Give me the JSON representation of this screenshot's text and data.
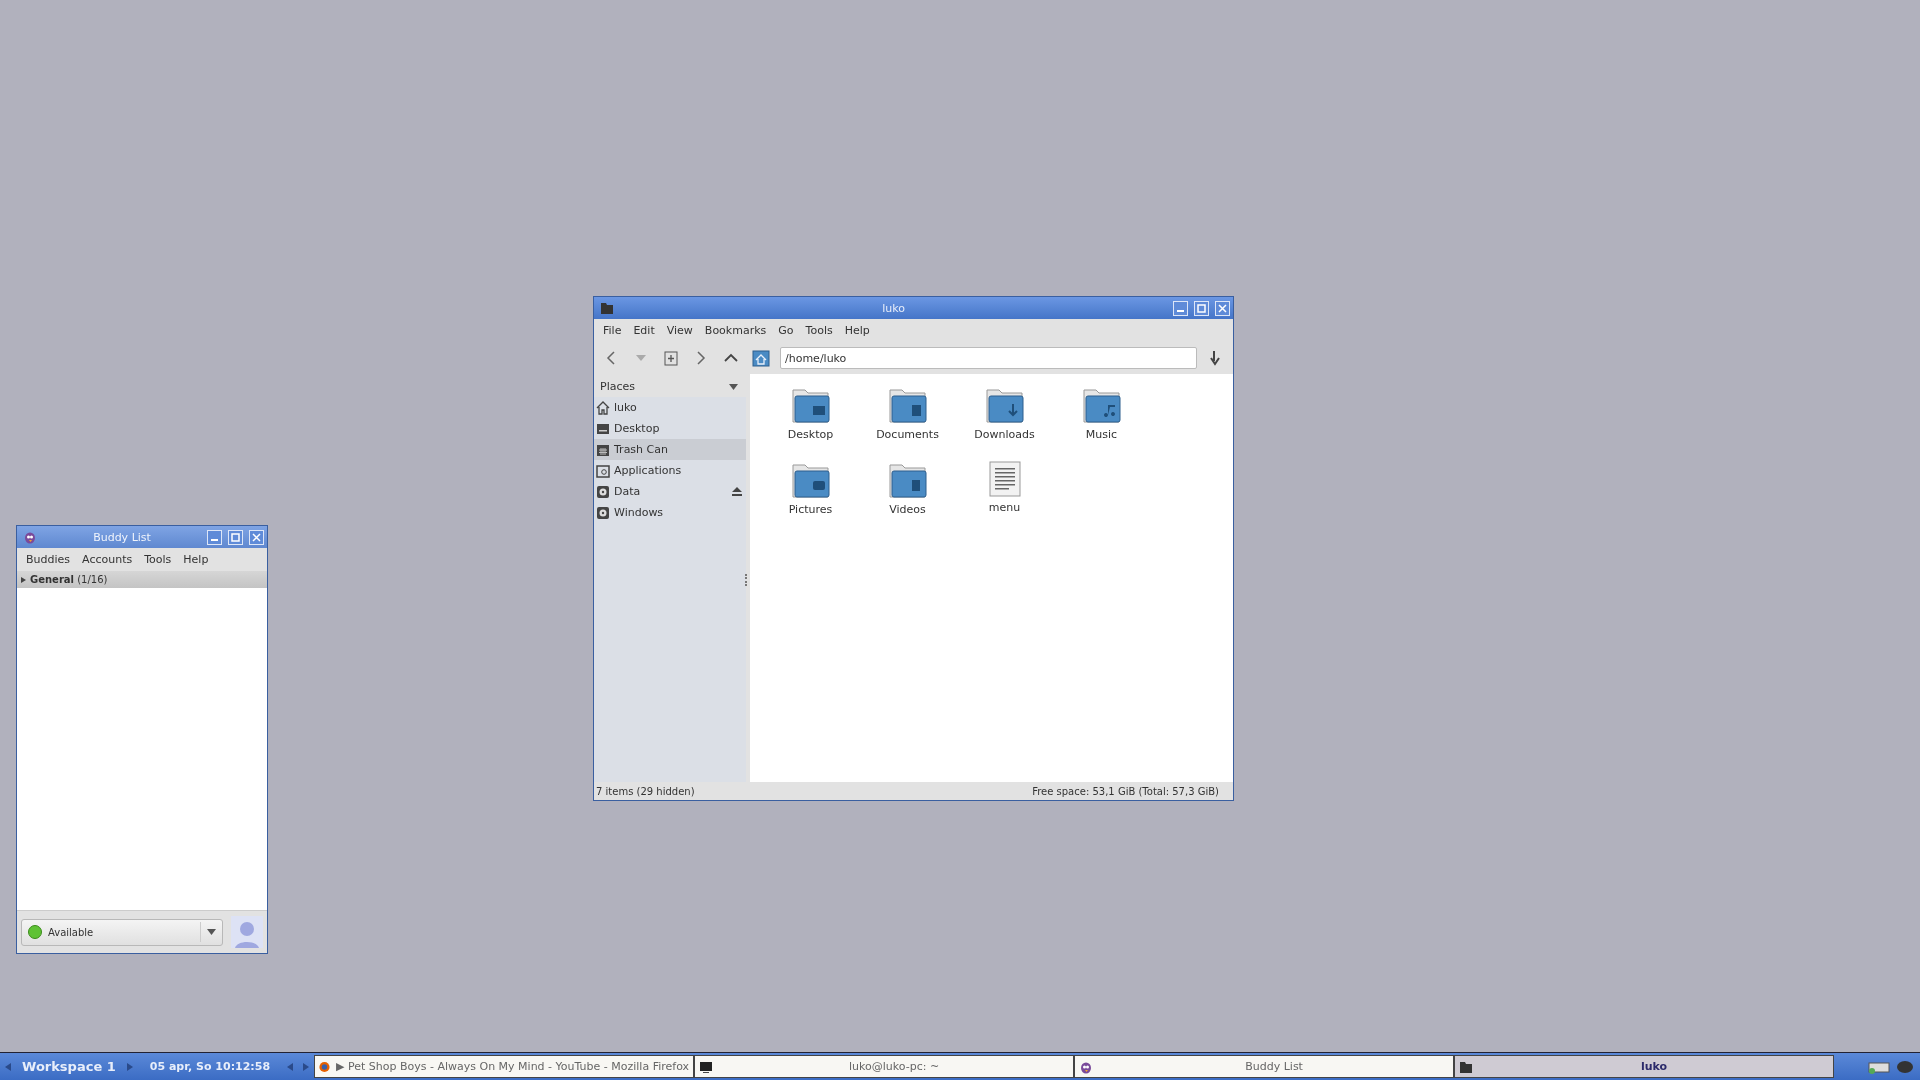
{
  "file_manager": {
    "title": "luko",
    "menu": [
      "File",
      "Edit",
      "View",
      "Bookmarks",
      "Go",
      "Tools",
      "Help"
    ],
    "location": "/home/luko",
    "places_header": "Places",
    "places": [
      {
        "label": "luko",
        "kind": "home",
        "selected": false,
        "eject": false
      },
      {
        "label": "Desktop",
        "kind": "desktop",
        "selected": false,
        "eject": false
      },
      {
        "label": "Trash Can",
        "kind": "trash",
        "selected": true,
        "eject": false
      },
      {
        "label": "Applications",
        "kind": "apps",
        "selected": false,
        "eject": false
      },
      {
        "label": "Data",
        "kind": "drive",
        "selected": false,
        "eject": true
      },
      {
        "label": "Windows",
        "kind": "drive",
        "selected": false,
        "eject": false
      }
    ],
    "files": [
      {
        "name": "Desktop",
        "kind": "desktop"
      },
      {
        "name": "Documents",
        "kind": "documents"
      },
      {
        "name": "Downloads",
        "kind": "downloads"
      },
      {
        "name": "Music",
        "kind": "music"
      },
      {
        "name": "Pictures",
        "kind": "pictures"
      },
      {
        "name": "Videos",
        "kind": "videos"
      },
      {
        "name": "menu",
        "kind": "text"
      }
    ],
    "status_left": "7 items (29 hidden)",
    "status_right": "Free space: 53,1 GiB (Total: 57,3 GiB)"
  },
  "buddy_list": {
    "title": "Buddy List",
    "menu": [
      "Buddies",
      "Accounts",
      "Tools",
      "Help"
    ],
    "group": "**General** (1/16)",
    "group_expanded": false,
    "status": "Available"
  },
  "taskbar": {
    "workspace": "Workspace 1",
    "clock": "05 apr, So 10:12:58",
    "tasks": [
      {
        "title": "▶ Pet Shop Boys - Always On My Mind - YouTube - Mozilla Firefox",
        "kind": "browser",
        "selected": false
      },
      {
        "title": "luko@luko-pc: ~",
        "kind": "terminal",
        "selected": false
      },
      {
        "title": "Buddy List",
        "kind": "bird",
        "selected": false
      },
      {
        "title": "luko",
        "kind": "folder",
        "selected": true
      }
    ]
  }
}
